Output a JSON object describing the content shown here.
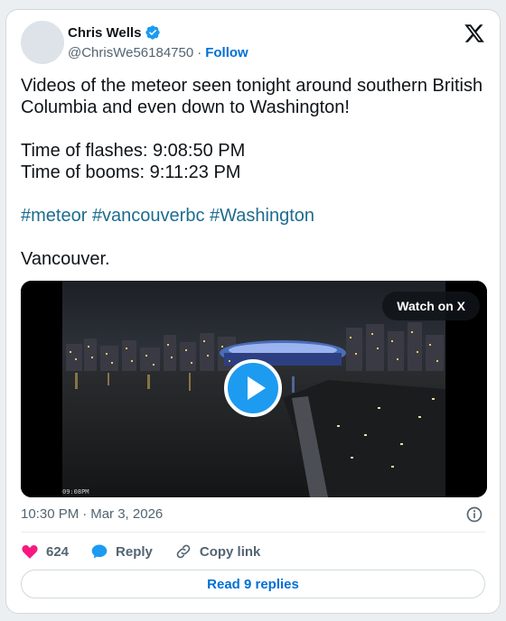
{
  "author": {
    "name": "Chris Wells",
    "handle": "@ChrisWe56184750",
    "separator": "·",
    "follow_label": "Follow",
    "verified": true
  },
  "icons": {
    "verified": "verified-badge-icon",
    "platform": "x-logo-icon",
    "info": "info-icon",
    "like": "heart-icon",
    "reply": "speech-bubble-icon",
    "copy": "link-icon",
    "play": "play-icon"
  },
  "tweet": {
    "line1": "Videos of the meteor seen tonight around southern British Columbia and even down to Washington!",
    "line2": "Time of flashes: 9:08:50 PM",
    "line3": "Time of booms: 9:11:23 PM",
    "hashtags": [
      "#meteor",
      "#vancouverbc",
      "#Washington"
    ],
    "location": "Vancouver."
  },
  "media": {
    "watch_label": "Watch on X",
    "camera_timestamp": "09:08PM"
  },
  "meta": {
    "time": "10:30 PM",
    "separator": "·",
    "date": "Mar 3, 2026"
  },
  "actions": {
    "like_count": "624",
    "reply_label": "Reply",
    "copy_label": "Copy link"
  },
  "read_replies_label": "Read 9 replies",
  "colors": {
    "link": "#006fd6",
    "hashtag": "#1d6c8f",
    "like": "#f91880",
    "reply_icon": "#1d9bf0",
    "play_button": "#1d9bf0"
  }
}
